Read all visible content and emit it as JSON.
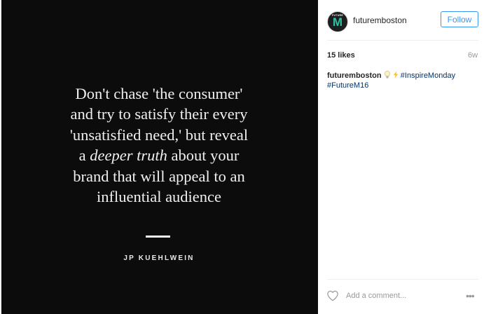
{
  "post": {
    "quote_lines": [
      "Don't chase 'the consumer'",
      "and try to satisfy their every",
      "'unsatisfied need,' but reveal"
    ],
    "quote_line4_prefix": "a ",
    "quote_line4_emphasis": "deeper truth",
    "quote_line4_suffix": " about your",
    "quote_lines_end": [
      "brand that will appeal to an",
      "influential audience"
    ],
    "author": "JP KUEHLWEIN",
    "colors": {
      "background": "#0c0c0c",
      "text": "#f0f0f0"
    }
  },
  "header": {
    "avatar_small_text": "FUTURE",
    "avatar_letter": "M",
    "username": "futuremboston",
    "follow_label": "Follow"
  },
  "stats": {
    "likes": "15 likes",
    "age": "6w"
  },
  "caption": {
    "username": "futuremboston",
    "emoji": [
      "lightbulb-icon",
      "lightning-icon"
    ],
    "hashtags": [
      "#InspireMonday",
      "#FutureM16"
    ]
  },
  "footer": {
    "comment_placeholder": "Add a comment...",
    "more_label": "•••"
  },
  "colors": {
    "link": "#3897f0",
    "hashtag": "#003569",
    "muted": "#999999"
  }
}
